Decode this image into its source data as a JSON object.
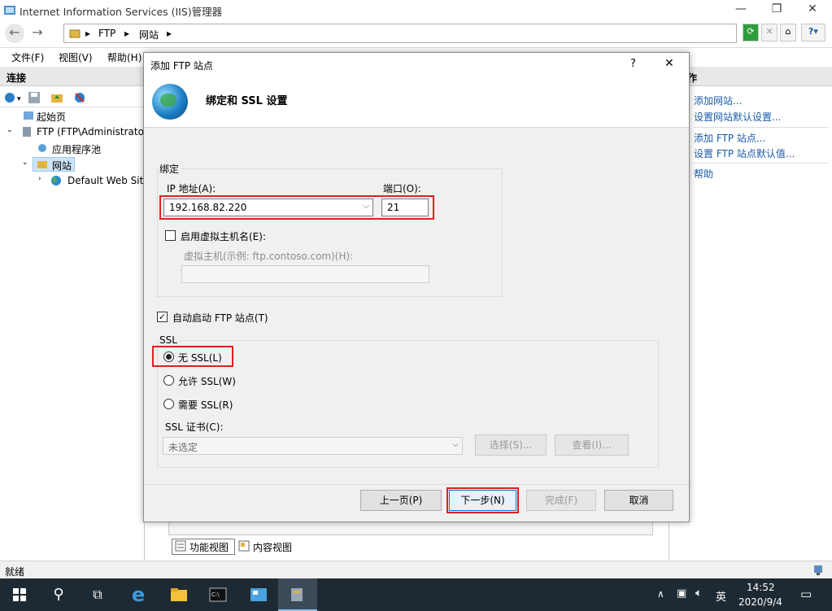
{
  "window": {
    "title": "Internet Information Services (IIS)管理器",
    "min": "—",
    "max": "❐",
    "close": "✕"
  },
  "address": {
    "crumbs": [
      "FTP",
      "网站"
    ]
  },
  "menu": [
    "文件(F)",
    "视图(V)",
    "帮助(H)"
  ],
  "left": {
    "header": "连接",
    "tree": [
      "起始页",
      "FTP (FTP\\Administrator",
      "应用程序池",
      "网站",
      "Default Web Site"
    ]
  },
  "right": {
    "header": "作",
    "links": [
      "添加网站...",
      "设置网站默认设置...",
      "添加 FTP 站点...",
      "设置 FTP 站点默认值...",
      "帮助"
    ]
  },
  "center": {
    "tabs": [
      "功能视图",
      "内容视图"
    ]
  },
  "status": {
    "text": "就绪"
  },
  "taskbar": {
    "time": "14:52",
    "date": "2020/9/4",
    "ime": "英"
  },
  "dialog": {
    "title": "添加 FTP 站点",
    "help": "?",
    "close": "✕",
    "heading": "绑定和 SSL 设置",
    "binding": {
      "legend": "绑定",
      "ip_label": "IP 地址(A):",
      "ip_value": "192.168.82.220",
      "port_label": "端口(O):",
      "port_value": "21",
      "vhost_check": "启用虚拟主机名(E):",
      "vhost_label": "虚拟主机(示例: ftp.contoso.com)(H):",
      "vhost_value": ""
    },
    "autostart": "自动启动 FTP 站点(T)",
    "ssl": {
      "legend": "SSL",
      "options": [
        "无 SSL(L)",
        "允许 SSL(W)",
        "需要 SSL(R)"
      ],
      "cert_label": "SSL 证书(C):",
      "cert_value": "未选定",
      "select": "选择(S)...",
      "view": "查看(I)..."
    },
    "buttons": {
      "prev": "上一页(P)",
      "next": "下一步(N)",
      "finish": "完成(F)",
      "cancel": "取消"
    }
  },
  "colors": {
    "accent_link": "#1a5aa6",
    "highlight": "#e02020",
    "taskbar": "#1e2a33"
  }
}
